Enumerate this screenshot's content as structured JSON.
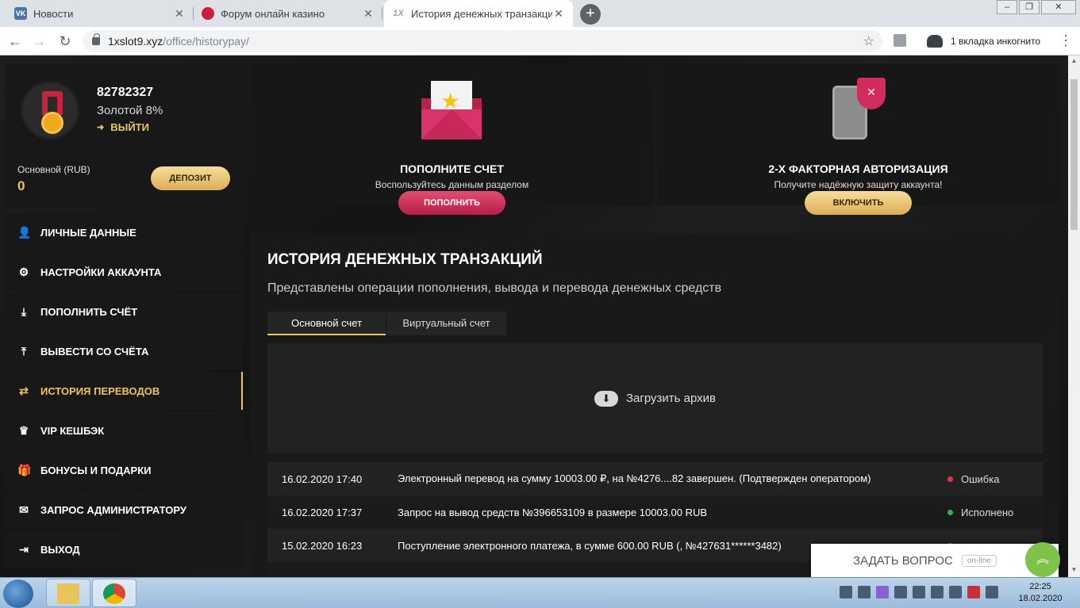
{
  "browser": {
    "tabs": [
      {
        "title": "Новости",
        "icon": "vk-icon"
      },
      {
        "title": "Форум онлайн казино",
        "icon": "casino-icon"
      },
      {
        "title": "История денежных транзакций",
        "icon": "1x-icon"
      }
    ],
    "url_domain": "1xslot9.xyz",
    "url_path": "/office/historypay/",
    "incognito_label": "1 вкладка инкогнито"
  },
  "profile": {
    "user_id": "82782327",
    "level": "Золотой 8%",
    "logout_label": "ВЫЙТИ",
    "balance_label": "Основной (RUB)",
    "balance_value": "0",
    "deposit_label": "ДЕПОЗИТ"
  },
  "menu": [
    {
      "label": "ЛИЧНЫЕ ДАННЫЕ",
      "icon": "user-add-icon",
      "active": false
    },
    {
      "label": "НАСТРОЙКИ АККАУНТА",
      "icon": "gears-icon",
      "active": false
    },
    {
      "label": "ПОПОЛНИТЬ СЧЁТ",
      "icon": "download-icon",
      "active": false
    },
    {
      "label": "ВЫВЕСТИ СО СЧЁТА",
      "icon": "upload-icon",
      "active": false
    },
    {
      "label": "ИСТОРИЯ ПЕРЕВОДОВ",
      "icon": "transfer-icon",
      "active": true
    },
    {
      "label": "VIP КЕШБЭК",
      "icon": "crown-icon",
      "active": false
    },
    {
      "label": "БОНУСЫ И ПОДАРКИ",
      "icon": "gift-icon",
      "active": false
    },
    {
      "label": "ЗАПРОС АДМИНИСТРАТОРУ",
      "icon": "envelope-icon",
      "active": false
    },
    {
      "label": "ВЫХОД",
      "icon": "exit-icon",
      "active": false
    }
  ],
  "cards": {
    "deposit": {
      "title": "ПОПОЛНИТЕ СЧЕТ",
      "text": "Воспользуйтесь данным разделом",
      "button": "ПОПОЛНИТЬ"
    },
    "twofa": {
      "title": "2-Х ФАКТОРНАЯ АВТОРИЗАЦИЯ",
      "text": "Получите надёжную защиту аккаунта!",
      "button": "ВКЛЮЧИТЬ"
    }
  },
  "history": {
    "title": "ИСТОРИЯ ДЕНЕЖНЫХ ТРАНЗАКЦИЙ",
    "subtitle": "Представлены операции пополнения, вывода и перевода денежных средств",
    "tabs": [
      "Основной счет",
      "Виртуальный счет"
    ],
    "archive_label": "Загрузить архив",
    "rows": [
      {
        "date": "16.02.2020 17:40",
        "description": "Электронный перевод на сумму 10003.00 ₽, на №4276....82 завершен. (Подтвержден оператором)",
        "status": "Ошибка",
        "status_color": "#e2344f"
      },
      {
        "date": "16.02.2020 17:37",
        "description": "Запрос на вывод средств №396653109 в размере 10003.00 RUB",
        "status": "Исполнено",
        "status_color": "#2db55d"
      },
      {
        "date": "15.02.2020 16:23",
        "description": "Поступление электронного платежа, в сумме 600.00 RUB (, №427631******3482)",
        "status": "",
        "status_color": "#2db55d"
      }
    ]
  },
  "chat": {
    "label": "ЗАДАТЬ ВОПРОС",
    "status": "on-line"
  },
  "taskbar": {
    "time": "22:25",
    "date": "18.02.2020"
  }
}
